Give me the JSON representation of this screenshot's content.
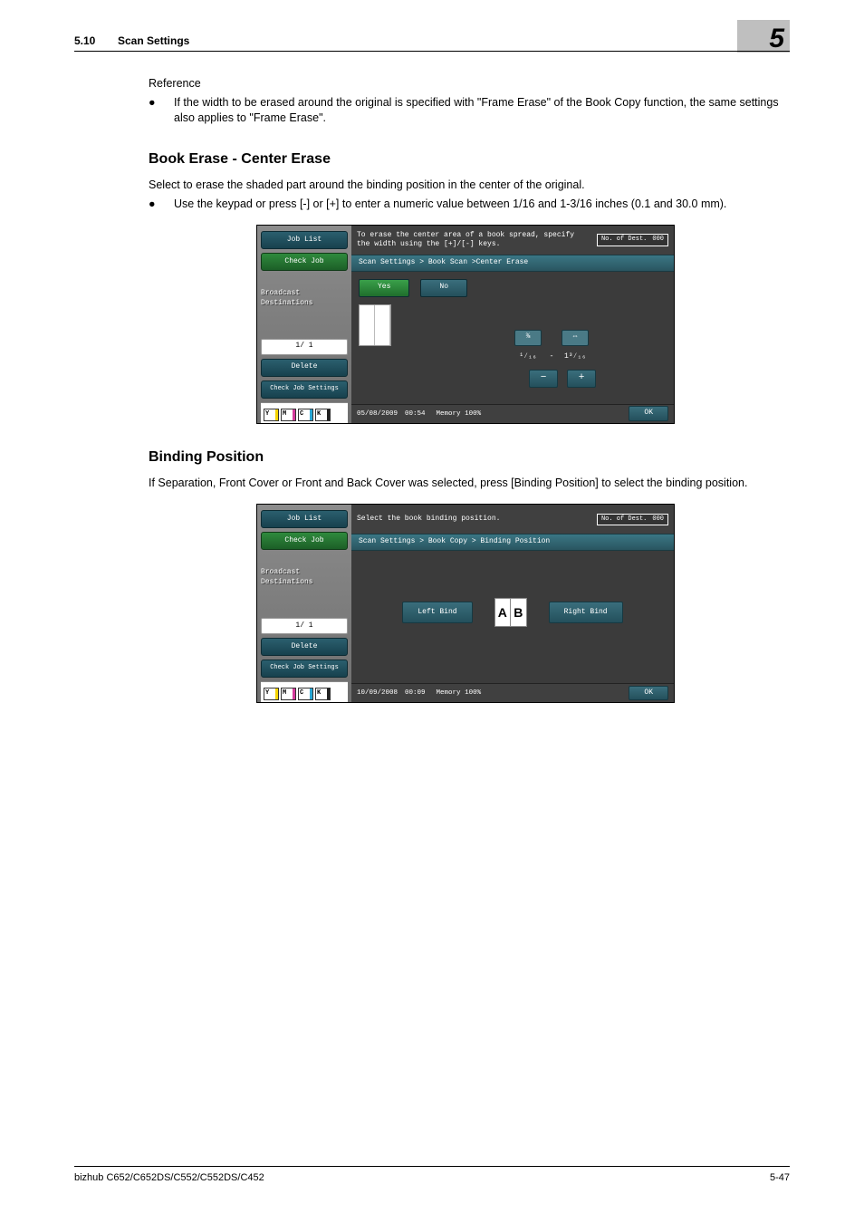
{
  "header": {
    "section_no": "5.10",
    "section_title": "Scan Settings",
    "chapter_no": "5"
  },
  "reference": {
    "label": "Reference",
    "bullet": "If the width to be erased around the original is specified with \"Frame Erase\" of the Book Copy function, the same settings also applies to \"Frame Erase\"."
  },
  "book_erase": {
    "heading": "Book Erase - Center Erase",
    "intro": "Select to erase the shaded part around the binding position in the center of the original.",
    "bullet": "Use the keypad or press [-] or [+] to enter a numeric value between 1/16 and 1-3/16 inches (0.1 and 30.0 mm)."
  },
  "panel1": {
    "side": {
      "job_list": "Job List",
      "check_job": "Check Job",
      "broadcast": "Broadcast Destinations",
      "page": "1/  1",
      "delete": "Delete",
      "check_settings": "Check Job Settings"
    },
    "instr": "To erase the center area of a book spread, specify the width using the [+]/[-] keys.",
    "dest_label": "No. of Dest.",
    "dest_count": "000",
    "breadcrumb": "Scan Settings > Book Scan >Center Erase",
    "yes": "Yes",
    "no": "No",
    "val_tl": "⅜",
    "val_tr": "⇔",
    "val_bl": "¹⁄₁₆",
    "val_br": "1³⁄₁₆",
    "dash": "-",
    "minus": "−",
    "plus": "+",
    "date": "05/08/2009",
    "time": "00:54",
    "mem_label": "Memory",
    "mem_val": "100%",
    "ok": "OK"
  },
  "binding": {
    "heading": "Binding Position",
    "intro": "If Separation, Front Cover or Front and Back Cover was selected, press [Binding Position] to select the binding position."
  },
  "panel2": {
    "instr": "Select the book binding position.",
    "breadcrumb": "Scan Settings > Book Copy > Binding Position",
    "left": "Left Bind",
    "right": "Right Bind",
    "iconA": "A",
    "iconB": "B",
    "date": "10/09/2008",
    "time": "00:09",
    "mem_label": "Memory",
    "mem_val": "100%",
    "ok": "OK",
    "dest_label": "No. of Dest.",
    "dest_count": "000",
    "page": "1/  1"
  },
  "footer": {
    "left": "bizhub C652/C652DS/C552/C552DS/C452",
    "right": "5-47"
  },
  "toner": {
    "y": "Y",
    "m": "M",
    "c": "C",
    "k": "K"
  }
}
